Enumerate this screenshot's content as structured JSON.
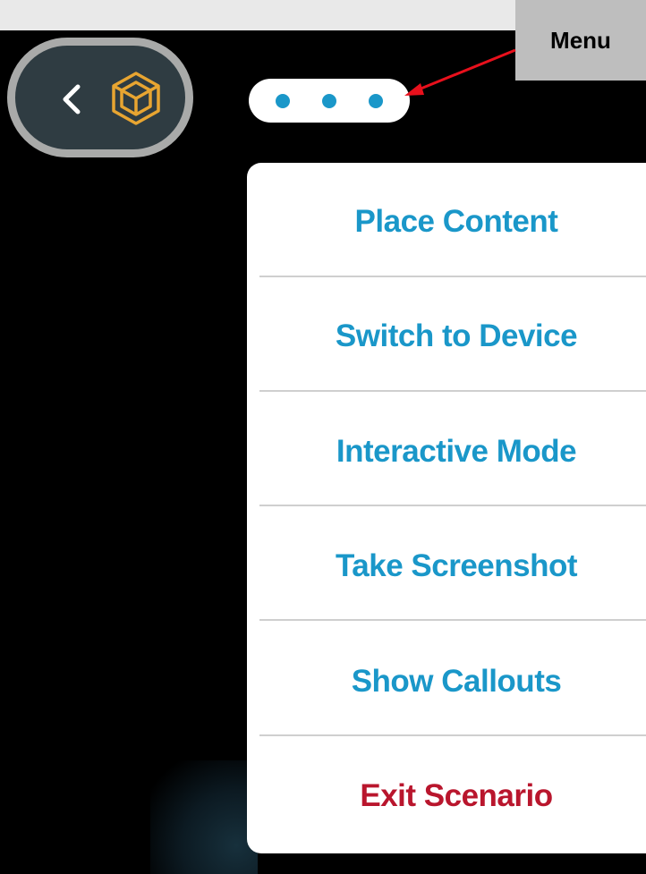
{
  "header": {
    "back_icon": "chevron-left-icon",
    "app_icon": "ar-cube-icon",
    "more_icon": "more-dots-icon"
  },
  "menu": {
    "items": [
      {
        "label": "Place Content",
        "style": "normal"
      },
      {
        "label": "Switch to Device",
        "style": "normal"
      },
      {
        "label": "Interactive Mode",
        "style": "normal"
      },
      {
        "label": "Take Screenshot",
        "style": "normal"
      },
      {
        "label": "Show Callouts",
        "style": "normal"
      },
      {
        "label": "Exit Scenario",
        "style": "danger"
      }
    ]
  },
  "annotation": {
    "label": "Menu",
    "arrow_color": "#e8101c"
  },
  "colors": {
    "accent": "#1a97c9",
    "danger": "#b9162d",
    "icon_gold": "#e8a531",
    "pill_bg": "#2f3c42",
    "pill_border": "#a9aaa9",
    "panel_bg": "#ffffff",
    "background": "#000000"
  }
}
